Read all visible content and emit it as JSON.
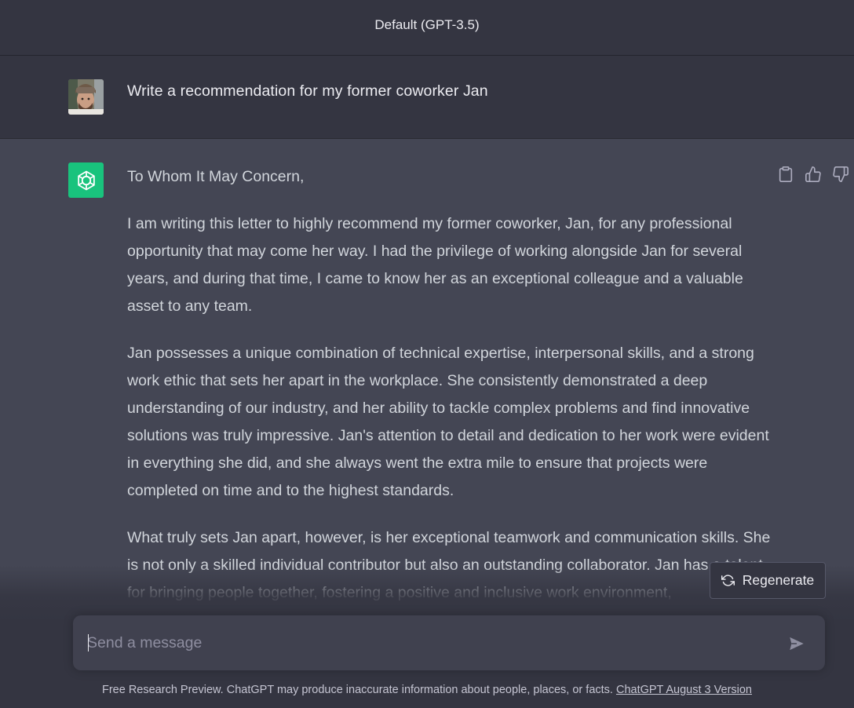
{
  "header": {
    "model": "Default (GPT-3.5)"
  },
  "user_message": {
    "text": "Write a recommendation for my former coworker Jan"
  },
  "assistant_message": {
    "paragraphs": [
      "To Whom It May Concern,",
      "I am writing this letter to highly recommend my former coworker, Jan, for any professional opportunity that may come her way. I had the privilege of working alongside Jan for several years, and during that time, I came to know her as an exceptional colleague and a valuable asset to any team.",
      "Jan possesses a unique combination of technical expertise, interpersonal skills, and a strong work ethic that sets her apart in the workplace. She consistently demonstrated a deep understanding of our industry, and her ability to tackle complex problems and find innovative solutions was truly impressive. Jan's attention to detail and dedication to her work were evident in everything she did, and she always went the extra mile to ensure that projects were completed on time and to the highest standards.",
      "What truly sets Jan apart, however, is her exceptional teamwork and communication skills. She is not only a skilled individual contributor but also an outstanding collaborator. Jan has a talent for bringing people together, fostering a positive and inclusive work environment,"
    ]
  },
  "actions": {
    "copy_icon": "clipboard-icon",
    "like_icon": "thumbs-up-icon",
    "dislike_icon": "thumbs-down-icon"
  },
  "regenerate": {
    "label": "Regenerate"
  },
  "composer": {
    "placeholder": "Send a message"
  },
  "footer": {
    "text": "Free Research Preview. ChatGPT may produce inaccurate information about people, places, or facts.",
    "link": "ChatGPT August 3 Version"
  },
  "colors": {
    "background": "#343541",
    "assistant_bg": "#444654",
    "brand": "#19c37d",
    "input_bg": "#40414f"
  }
}
